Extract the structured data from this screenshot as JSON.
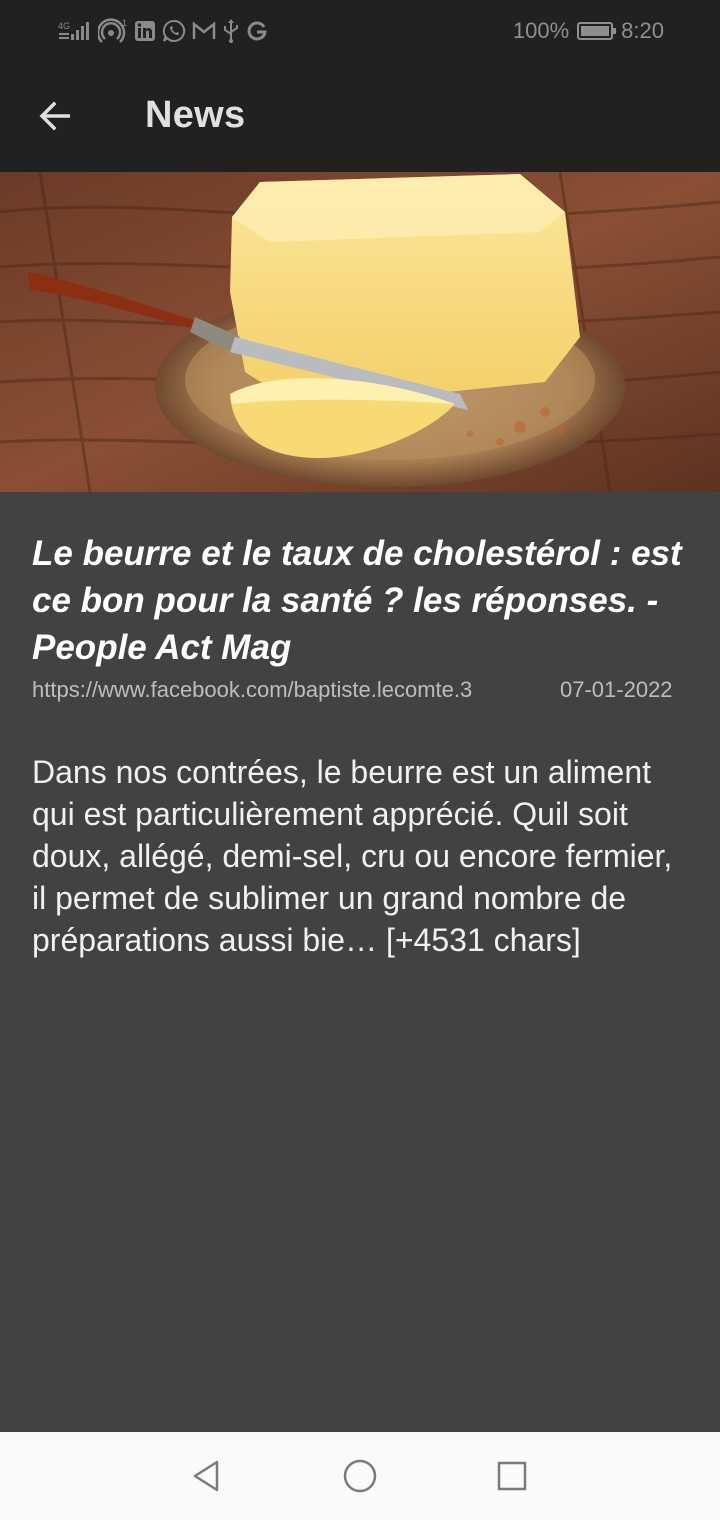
{
  "status_bar": {
    "network_label": "4G",
    "sim_index": "1",
    "battery_percent": "100%",
    "time": "8:20",
    "icons": [
      "signal-icon",
      "hotspot-icon",
      "linkedin-icon",
      "whatsapp-icon",
      "gmail-icon",
      "usb-icon",
      "google-icon",
      "battery-icon"
    ]
  },
  "app_bar": {
    "title": "News",
    "back_icon": "arrow-left-icon"
  },
  "article": {
    "image_alt": "butter-image",
    "title": "Le beurre et le taux de cholestérol : est ce bon pour la santé ? les réponses. - People Act Mag",
    "source_url": "https://www.facebook.com/baptiste.lecomte.3",
    "date": "07-01-2022",
    "content": "Dans nos contrées, le beurre est un aliment qui est particulièrement apprécié. Quil soit doux, allégé, demi-sel, cru ou encore fermier, il permet de sublimer un grand nombre de préparations aussi bie… [+4531 chars]"
  },
  "nav_bar": {
    "icons": [
      "back-triangle-icon",
      "home-circle-icon",
      "recents-square-icon"
    ]
  },
  "colors": {
    "background": "#424242",
    "app_bar": "#212121",
    "text_primary": "#ffffff",
    "nav_bar": "#fafafa"
  }
}
